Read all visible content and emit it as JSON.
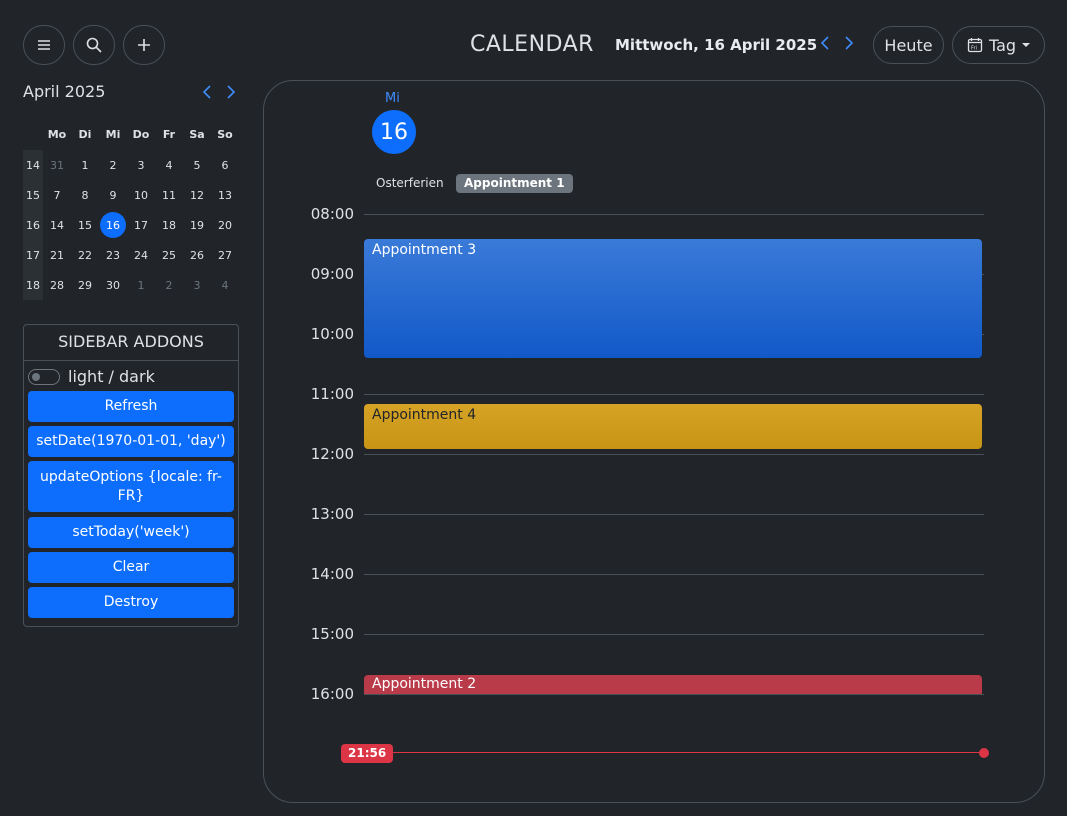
{
  "header": {
    "title": "CALENDAR",
    "current_date": "Mittwoch, 16 April 2025",
    "today_label": "Heute",
    "view_label": "Tag"
  },
  "mini_calendar": {
    "month_label": "April 2025",
    "weekdays": [
      "Mo",
      "Di",
      "Mi",
      "Do",
      "Fr",
      "Sa",
      "So"
    ],
    "weeks": [
      {
        "wk": "14",
        "days": [
          "31",
          "1",
          "2",
          "3",
          "4",
          "5",
          "6"
        ]
      },
      {
        "wk": "15",
        "days": [
          "7",
          "8",
          "9",
          "10",
          "11",
          "12",
          "13"
        ]
      },
      {
        "wk": "16",
        "days": [
          "14",
          "15",
          "16",
          "17",
          "18",
          "19",
          "20"
        ]
      },
      {
        "wk": "17",
        "days": [
          "21",
          "22",
          "23",
          "24",
          "25",
          "26",
          "27"
        ]
      },
      {
        "wk": "18",
        "days": [
          "28",
          "29",
          "30",
          "1",
          "2",
          "3",
          "4"
        ]
      }
    ],
    "selected_day": "16"
  },
  "sidebar_addons": {
    "title": "SIDEBAR ADDONS",
    "toggle_label": "light / dark",
    "buttons": [
      "Refresh",
      "setDate(1970-01-01, 'day')",
      "updateOptions {locale: fr-FR}",
      "setToday('week')",
      "Clear",
      "Destroy"
    ]
  },
  "day_view": {
    "day_abbr": "Mi",
    "day_number": "16",
    "allday_label": "Osterferien",
    "allday_event": "Appointment 1",
    "hours": [
      "08:00",
      "09:00",
      "10:00",
      "11:00",
      "12:00",
      "13:00",
      "14:00",
      "15:00",
      "16:00"
    ],
    "events": {
      "ev3": "Appointment 3",
      "ev4": "Appointment 4",
      "ev2": "Appointment 2"
    },
    "now_time": "21:56"
  },
  "colors": {
    "accent": "#0d6efd",
    "event_blue": "#1d63d0",
    "event_yellow": "#cf9b1c",
    "event_red": "#b93a48",
    "now_red": "#dc3545"
  }
}
